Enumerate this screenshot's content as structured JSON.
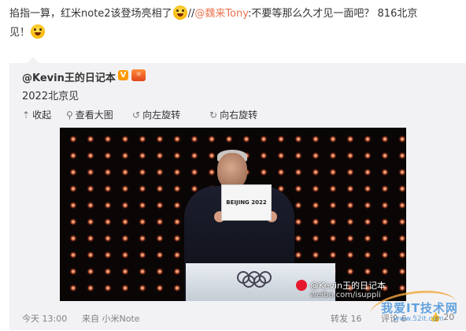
{
  "post": {
    "text_part1": "掐指一算，红米note2该登场亮相了",
    "separator": "//",
    "mention": "@魏来Tony",
    "text_part2": ":不要等那么久才见一面吧？ 816北京",
    "text_part3": "见！"
  },
  "repost": {
    "author": "@Kevin王的日记本",
    "text": "2022北京见",
    "toolbar": {
      "collapse": "收起",
      "view_large": "查看大图",
      "rotate_left": "向左旋转",
      "rotate_right": "向右旋转"
    },
    "image": {
      "card_text": "BEIJING 2022",
      "watermark_name": "@Kevin王的日记本",
      "watermark_url": "weibo.com/isuppli"
    },
    "footer": {
      "time": "今天 13:00",
      "source": "来自 小米Note",
      "repost_label": "转发",
      "repost_count": "16",
      "comment_label": "评论",
      "comment_count": "6",
      "like_count": "20"
    }
  },
  "site_watermark": {
    "title": "我爱IT技术网",
    "url": "www.52it.com"
  },
  "colors": {
    "mention": "#eb7350",
    "repost_bg": "#f2f2f5",
    "footer_text": "#808080"
  },
  "icons": [
    "emoji-laugh-icon",
    "verified-v-icon",
    "member-badge-icon",
    "collapse-icon",
    "magnify-icon",
    "rotate-left-icon",
    "rotate-right-icon",
    "weibo-logo-icon",
    "like-icon"
  ]
}
